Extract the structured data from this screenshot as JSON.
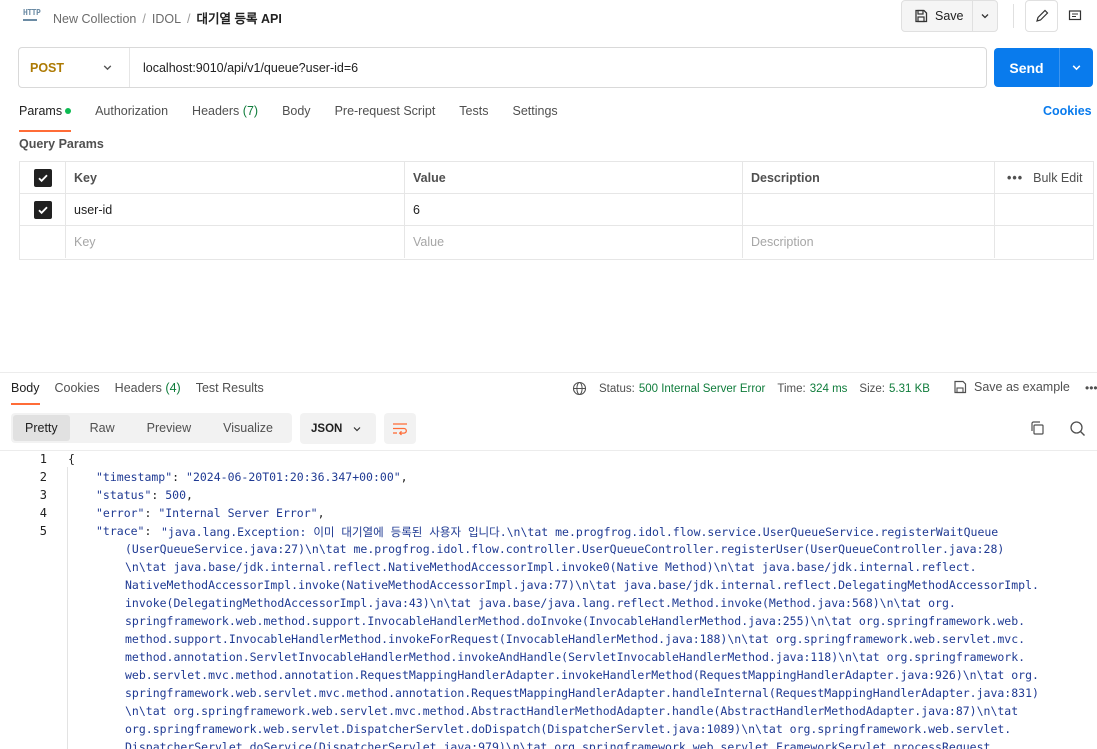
{
  "header": {
    "icon_label": "HTTP",
    "breadcrumb": [
      "New Collection",
      "IDOL"
    ],
    "current": "대기열 등록 API",
    "save_label": "Save"
  },
  "request": {
    "method": "POST",
    "url": "localhost:9010/api/v1/queue?user-id=6",
    "send_label": "Send"
  },
  "request_tabs": {
    "params": "Params",
    "authorization": "Authorization",
    "headers": "Headers",
    "headers_count": "(7)",
    "body": "Body",
    "prerequest": "Pre-request Script",
    "tests": "Tests",
    "settings": "Settings",
    "cookies": "Cookies"
  },
  "query_params": {
    "title": "Query Params",
    "columns": {
      "key": "Key",
      "value": "Value",
      "description": "Description",
      "bulk_edit": "Bulk Edit"
    },
    "rows": [
      {
        "key": "user-id",
        "value": "6",
        "checked": true
      }
    ],
    "placeholders": {
      "key": "Key",
      "value": "Value",
      "description": "Description"
    }
  },
  "response_tabs": {
    "body": "Body",
    "cookies": "Cookies",
    "headers": "Headers",
    "headers_count": "(4)",
    "test_results": "Test Results"
  },
  "response_meta": {
    "status_label": "Status:",
    "status_value": "500 Internal Server Error",
    "time_label": "Time:",
    "time_value": "324 ms",
    "size_label": "Size:",
    "size_value": "5.31 KB",
    "save_example": "Save as example"
  },
  "view": {
    "modes": [
      "Pretty",
      "Raw",
      "Preview",
      "Visualize"
    ],
    "format": "JSON"
  },
  "code": {
    "line_numbers": [
      "1",
      "2",
      "3",
      "4",
      "5"
    ],
    "open_brace": "{",
    "timestamp_key": "\"timestamp\"",
    "timestamp_val": "\"2024-06-20T01:20:36.347+00:00\"",
    "status_key": "\"status\"",
    "status_val": "500",
    "error_key": "\"error\"",
    "error_val": "\"Internal Server Error\"",
    "trace_key": "\"trace\"",
    "trace_lines": [
      "\"java.lang.Exception: 이미 대기열에 등록된 사용자 입니다.\\n\\tat me.progfrog.idol.flow.service.UserQueueService.registerWaitQueue",
      "(UserQueueService.java:27)\\n\\tat me.progfrog.idol.flow.controller.UserQueueController.registerUser(UserQueueController.java:28)",
      "\\n\\tat java.base/jdk.internal.reflect.NativeMethodAccessorImpl.invoke0(Native Method)\\n\\tat java.base/jdk.internal.reflect.",
      "NativeMethodAccessorImpl.invoke(NativeMethodAccessorImpl.java:77)\\n\\tat java.base/jdk.internal.reflect.DelegatingMethodAccessorImpl.",
      "invoke(DelegatingMethodAccessorImpl.java:43)\\n\\tat java.base/java.lang.reflect.Method.invoke(Method.java:568)\\n\\tat org.",
      "springframework.web.method.support.InvocableHandlerMethod.doInvoke(InvocableHandlerMethod.java:255)\\n\\tat org.springframework.web.",
      "method.support.InvocableHandlerMethod.invokeForRequest(InvocableHandlerMethod.java:188)\\n\\tat org.springframework.web.servlet.mvc.",
      "method.annotation.ServletInvocableHandlerMethod.invokeAndHandle(ServletInvocableHandlerMethod.java:118)\\n\\tat org.springframework.",
      "web.servlet.mvc.method.annotation.RequestMappingHandlerAdapter.invokeHandlerMethod(RequestMappingHandlerAdapter.java:926)\\n\\tat org.",
      "springframework.web.servlet.mvc.method.annotation.RequestMappingHandlerAdapter.handleInternal(RequestMappingHandlerAdapter.java:831)",
      "\\n\\tat org.springframework.web.servlet.mvc.method.AbstractHandlerMethodAdapter.handle(AbstractHandlerMethodAdapter.java:87)\\n\\tat",
      "org.springframework.web.servlet.DispatcherServlet.doDispatch(DispatcherServlet.java:1089)\\n\\tat org.springframework.web.servlet.",
      "DispatcherServlet.doService(DispatcherServlet.java:979)\\n\\tat org.springframework.web.servlet.FrameworkServlet.processRequest"
    ]
  },
  "colors": {
    "accent": "#ff6c37",
    "send": "#097bed",
    "method": "#ad7a03",
    "status_error": "#0f7c3b"
  },
  "icons": [
    "http-icon",
    "save-icon",
    "chevron-down-icon",
    "pencil-icon",
    "comment-icon",
    "globe-icon",
    "more-icon",
    "copy-icon",
    "search-icon",
    "wrap-icon",
    "checkbox-icon"
  ]
}
